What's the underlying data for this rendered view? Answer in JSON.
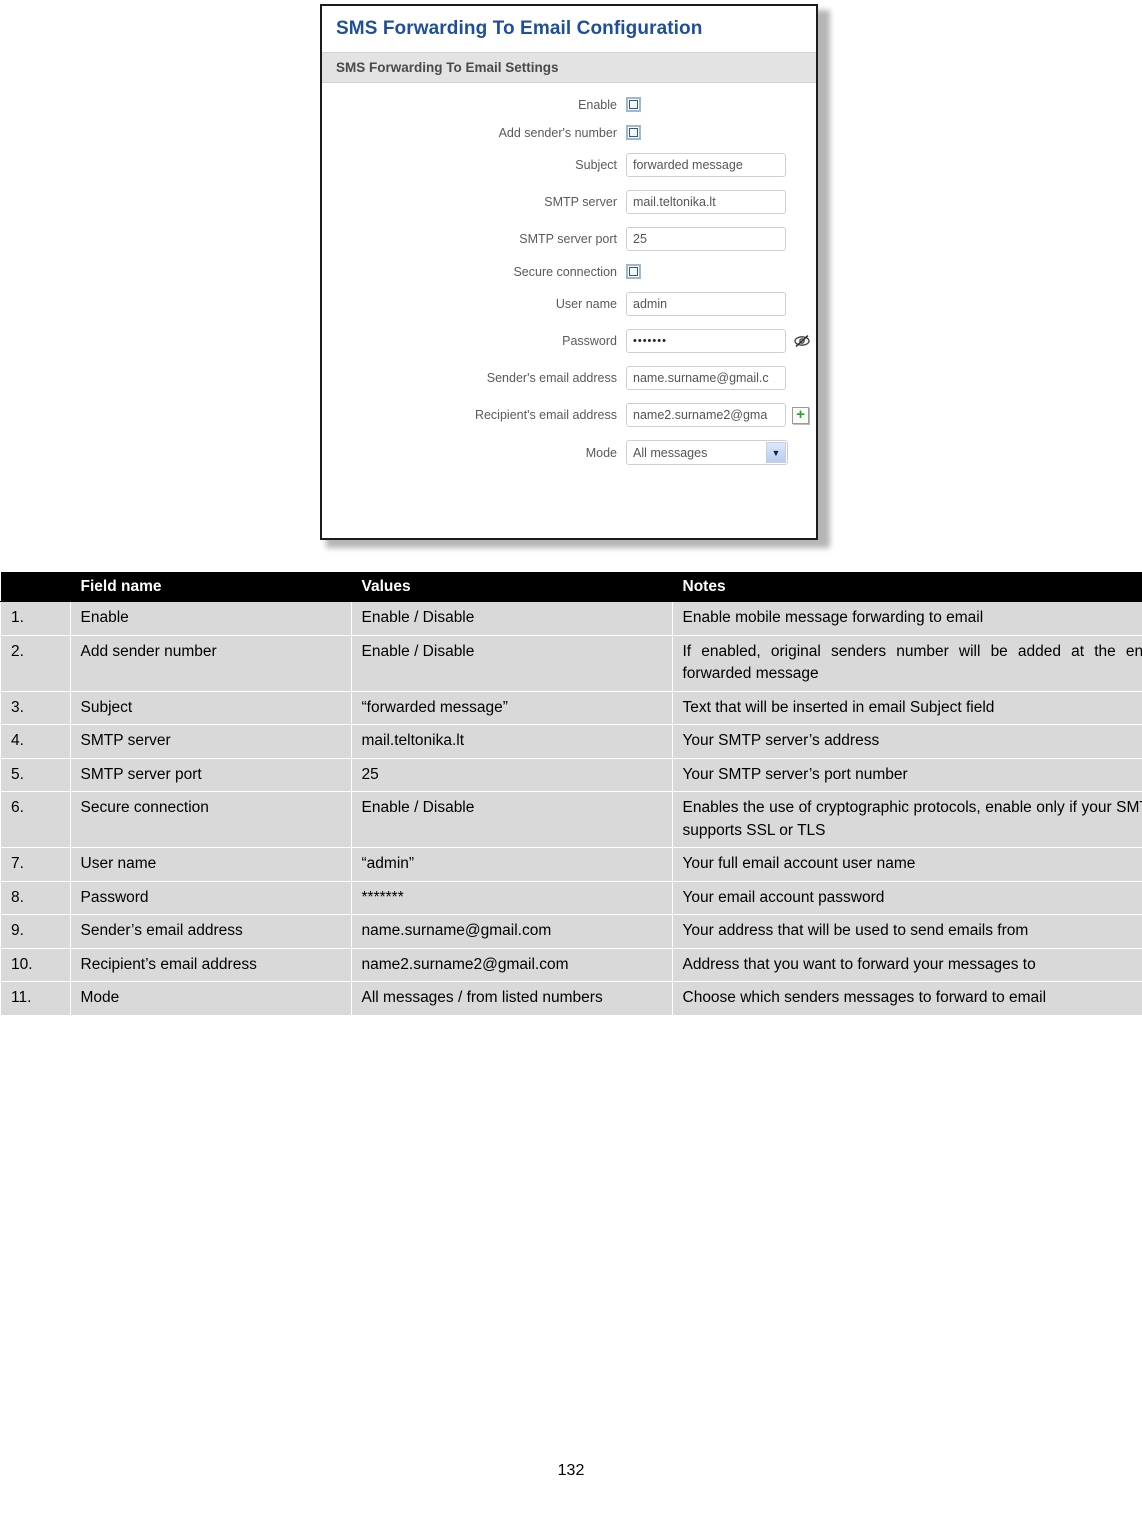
{
  "screenshot_panel": {
    "title": "SMS Forwarding To Email Configuration",
    "section_header": "SMS Forwarding To Email Settings",
    "fields": [
      {
        "label": "Enable",
        "type": "checkbox",
        "checked": false
      },
      {
        "label": "Add sender's number",
        "type": "checkbox",
        "checked": false
      },
      {
        "label": "Subject",
        "type": "text",
        "value": "forwarded message"
      },
      {
        "label": "SMTP server",
        "type": "text",
        "value": "mail.teltonika.lt"
      },
      {
        "label": "SMTP server port",
        "type": "text",
        "value": "25"
      },
      {
        "label": "Secure connection",
        "type": "checkbox",
        "checked": false
      },
      {
        "label": "User name",
        "type": "text",
        "value": "admin"
      },
      {
        "label": "Password",
        "type": "password",
        "value": "•••••••",
        "icon": "eye-slash-icon"
      },
      {
        "label": "Sender's email address",
        "type": "text",
        "value": "name.surname@gmail.c"
      },
      {
        "label": "Recipient's email address",
        "type": "text",
        "value": "name2.surname2@gma",
        "icon": "plus-add-icon"
      },
      {
        "label": "Mode",
        "type": "select",
        "value": "All messages"
      }
    ],
    "colors": {
      "title_blue": "#1f4e9c",
      "section_bar": "#e3e3e3",
      "panel_border": "#1b1b1b",
      "checkbox_border": "#2b5b8c",
      "plus_green": "#2aa02a",
      "select_button": "#b8cdf0"
    }
  },
  "table": {
    "headers": [
      "",
      "Field name",
      "Values",
      "Notes"
    ],
    "rows": [
      {
        "num": "1.",
        "field": "Enable",
        "value": "Enable / Disable",
        "note": "Enable mobile message forwarding to email"
      },
      {
        "num": "2.",
        "field": "Add sender number",
        "value": "Enable / Disable",
        "note": "If enabled, original senders number will be added at the end of the forwarded message"
      },
      {
        "num": "3.",
        "field": "Subject",
        "value": "“forwarded message”",
        "note": "Text that will be inserted in email Subject field"
      },
      {
        "num": "4.",
        "field": "SMTP server",
        "value": "mail.teltonika.lt",
        "note": "Your SMTP server’s address"
      },
      {
        "num": "5.",
        "field": "SMTP server port",
        "value": "25",
        "note": "Your SMTP server’s port number"
      },
      {
        "num": "6.",
        "field": "Secure connection",
        "value": "Enable / Disable",
        "note": "Enables the use of cryptographic protocols, enable only if your SMTP server supports SSL or TLS"
      },
      {
        "num": "7.",
        "field": "User name",
        "value": "“admin”",
        "note": "Your full email account user name"
      },
      {
        "num": "8.",
        "field": "Password",
        "value": "*******",
        "note": "Your email account password"
      },
      {
        "num": "9.",
        "field": "Sender’s email address",
        "value": "name.surname@gmail.com",
        "note": "Your address that will be used to send emails from"
      },
      {
        "num": "10.",
        "field": "Recipient’s email address",
        "value": "name2.surname2@gmail.com",
        "note": "Address that you want to forward your messages to"
      },
      {
        "num": "11.",
        "field": "Mode",
        "value": "All messages / from listed numbers",
        "note": "Choose which senders messages to forward to email"
      }
    ],
    "justified_rows": [
      1,
      5
    ]
  },
  "footer": {
    "page_number": "132"
  }
}
